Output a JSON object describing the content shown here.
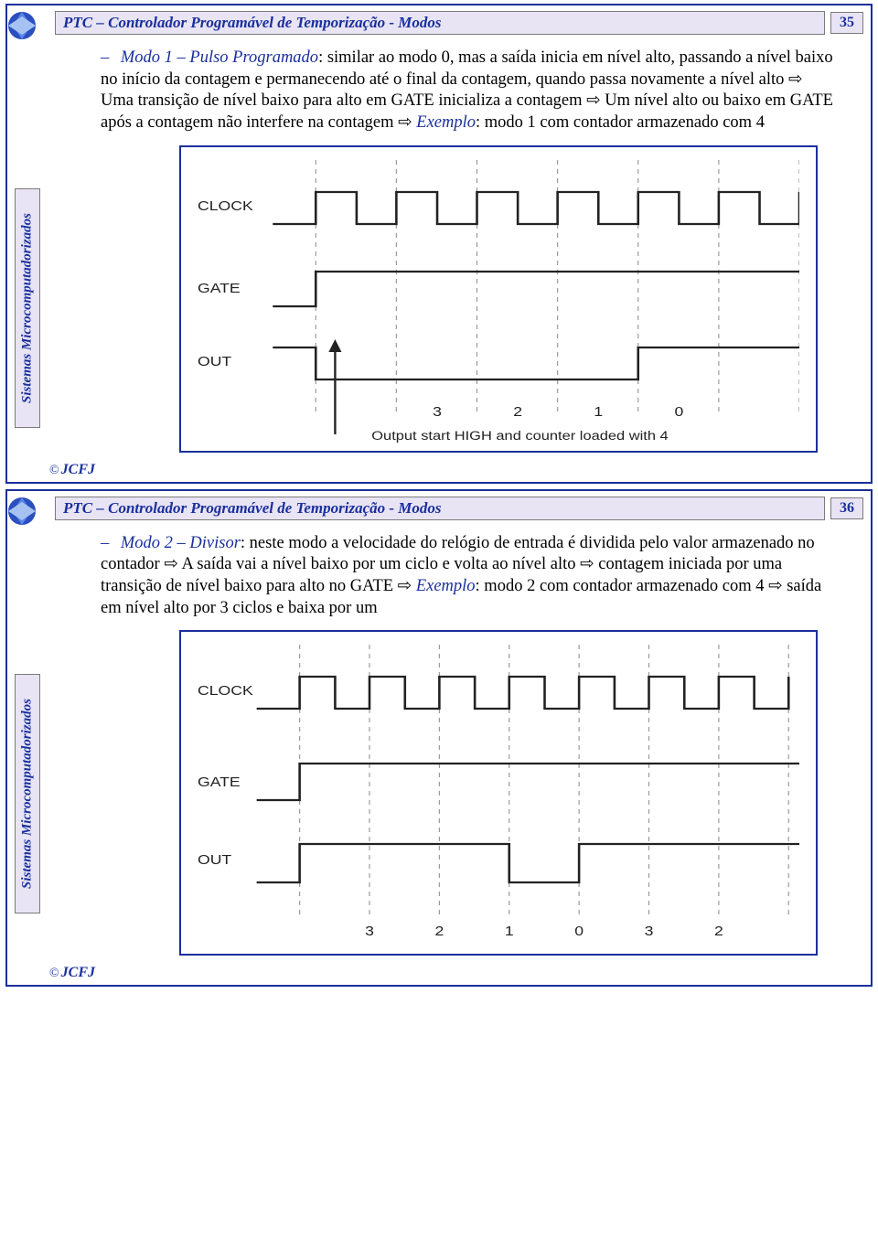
{
  "slides": [
    {
      "title": "PTC – Controlador Programável de Temporização  - Modos",
      "page": "35",
      "side_label": "Sistemas Microcomputadorizados",
      "mode_name": "Modo 1 – Pulso Programado",
      "body_after": ": similar ao modo 0, mas a saída inicia em nível alto, passando a nível baixo no início da contagem e permanecendo até o final da contagem, quando passa novamente a nível alto ⇨ Uma transição de nível baixo para alto em GATE inicializa a contagem ⇨ Um  nível alto ou baixo em GATE após a contagem não interfere na contagem ⇨ ",
      "exemplo_label": "Exemplo",
      "exemplo_text": ": modo 1 com contador armazenado com 4",
      "signals": {
        "clock": "CLOCK",
        "gate": "GATE",
        "out": "OUT"
      },
      "counts": [
        "3",
        "2",
        "1",
        "0"
      ],
      "caption": "Output start HIGH and counter loaded with 4",
      "footer": "JCFJ"
    },
    {
      "title": "PTC – Controlador Programável de Temporização  - Modos",
      "page": "36",
      "side_label": "Sistemas Microcomputadorizados",
      "mode_name": "Modo 2 – Divisor",
      "body_after": ": neste modo a velocidade do relógio de entrada é dividida pelo valor armazenado no contador ⇨ A saída vai a nível baixo por um ciclo e volta ao nível alto ⇨ contagem iniciada por uma transição de nível baixo para alto no GATE ⇨ ",
      "exemplo_label": "Exemplo",
      "exemplo_text": ": modo 2 com contador armazenado com 4 ⇨ saída em nível alto por 3 ciclos e baixa por um",
      "signals": {
        "clock": "CLOCK",
        "gate": "GATE",
        "out": "OUT"
      },
      "counts": [
        "3",
        "2",
        "1",
        "0",
        "3",
        "2"
      ],
      "caption": "",
      "footer": "JCFJ"
    }
  ]
}
